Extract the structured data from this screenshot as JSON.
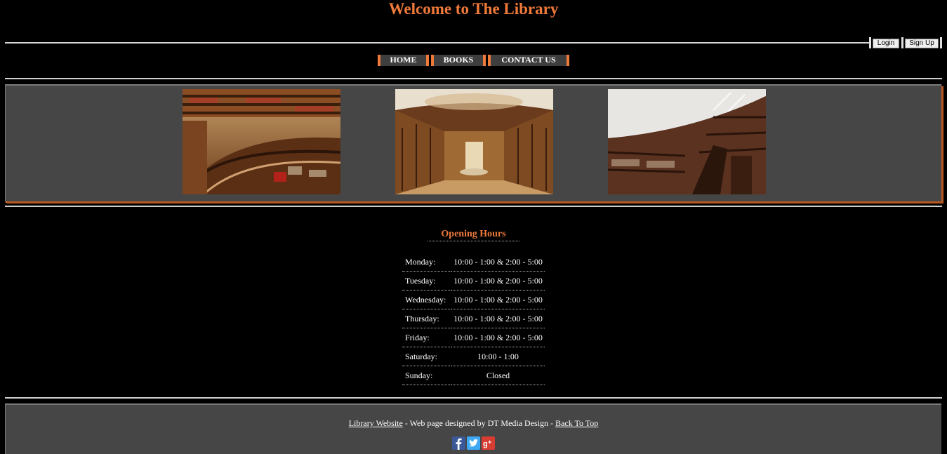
{
  "header": {
    "title": "Welcome to The Library"
  },
  "auth": {
    "login_label": "Login",
    "signup_label": "Sign Up"
  },
  "nav": {
    "items": [
      "HOME",
      "BOOKS",
      "CONTACT US"
    ]
  },
  "gallery": {
    "images": [
      "library-rotunda-photo",
      "baroque-library-hall-photo",
      "circular-library-stacks-photo"
    ]
  },
  "hours": {
    "title": "Opening Hours",
    "rows": [
      {
        "day": "Monday:",
        "time": "10:00 - 1:00 & 2:00 - 5:00"
      },
      {
        "day": "Tuesday:",
        "time": "10:00 - 1:00 & 2:00 - 5:00"
      },
      {
        "day": "Wednesday:",
        "time": "10:00 - 1:00 & 2:00 - 5:00"
      },
      {
        "day": "Thursday:",
        "time": "10:00 - 1:00 & 2:00 - 5:00"
      },
      {
        "day": "Friday:",
        "time": "10:00 - 1:00 & 2:00 - 5:00"
      },
      {
        "day": "Saturday:",
        "time": "10:00 - 1:00"
      },
      {
        "day": "Sunday:",
        "time": "Closed"
      }
    ]
  },
  "footer": {
    "site_link": "Library Website",
    "designer_text": " - Web page designed by DT Media Design - ",
    "top_link": "Back To Top",
    "social": [
      "facebook-icon",
      "twitter-icon",
      "google-plus-icon"
    ]
  },
  "colors": {
    "accent": "#f07a3a",
    "panel": "#464646",
    "background": "#000000"
  }
}
